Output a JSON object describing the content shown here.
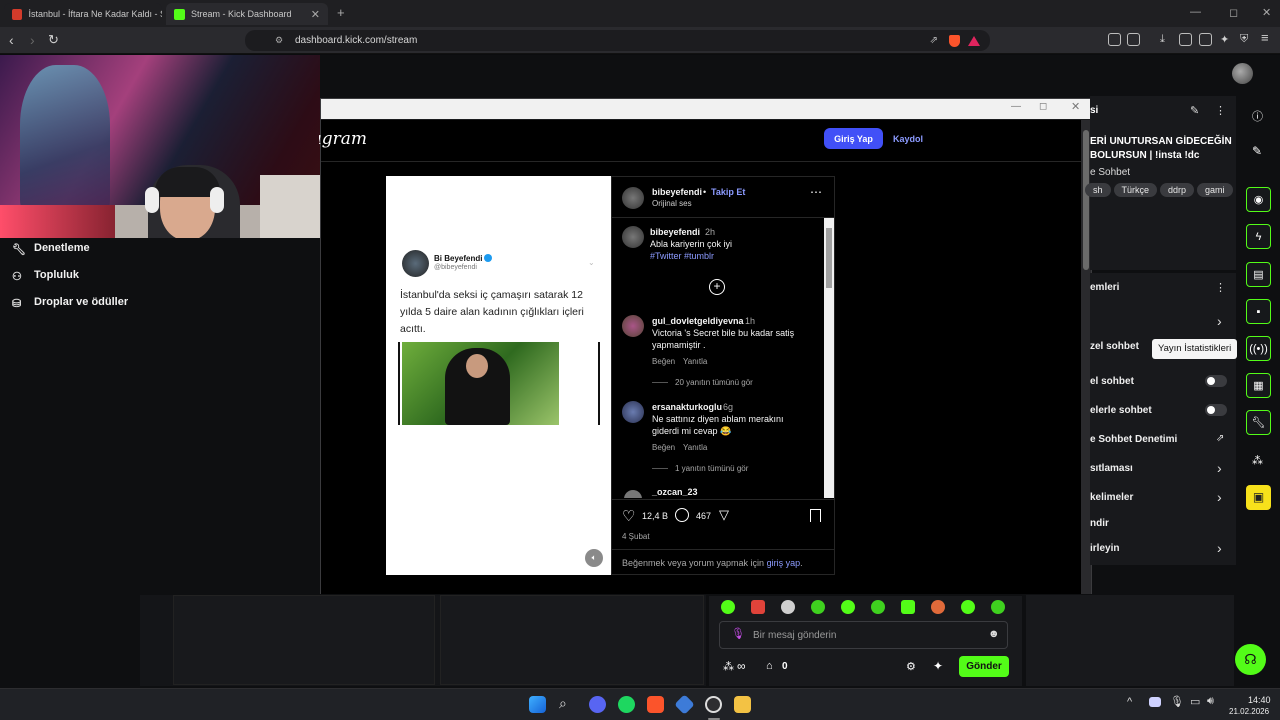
{
  "browser": {
    "tabs": [
      {
        "label": "İstanbul - İftara Ne Kadar Kaldı - Sah",
        "favicon_color": "#d23b2b"
      },
      {
        "label": "Stream - Kick Dashboard",
        "favicon_color": "#53fc18"
      }
    ],
    "new_tab": "+",
    "url": "dashboard.kick.com/stream"
  },
  "sidebar": {
    "items": [
      {
        "label": "Denetleme",
        "icon": "wrench-icon"
      },
      {
        "label": "Topluluk",
        "icon": "people-icon"
      },
      {
        "label": "Droplar ve ödüller",
        "icon": "gift-icon"
      }
    ]
  },
  "popup": {
    "instagram": {
      "logo": "Instagram",
      "login_label": "Giriş Yap",
      "signup_label": "Kaydol",
      "tweet": {
        "name": "Bi Beyefendi",
        "handle": "@bibeyefendi",
        "text": "İstanbul'da seksi iç çamaşırı satarak 12 yılda 5 daire alan kadının çığlıkları içleri acıttı."
      },
      "post": {
        "author": "bibeyefendi",
        "follow": "Takip Et",
        "audio": "Orijinal ses",
        "caption_author": "bibeyefendi",
        "caption_time": "2h",
        "caption": "Abla kariyerin çok iyi",
        "hashtags": "#Twitter #tumblr",
        "comments": [
          {
            "user": "gul_dovletgeldiyevna",
            "time": "1h",
            "text": "Victoria 's Secret bile bu kadar satiş yapmamiştir .",
            "like": "Beğen",
            "reply": "Yanıtla",
            "more": "20 yanıtın tümünü gör"
          },
          {
            "user": "ersanakturkoglu",
            "time": "6g",
            "text": "Ne sattınız diyen ablam merakını giderdi mi cevap 😂",
            "like": "Beğen",
            "reply": "Yanıtla",
            "more": "1 yanıtın tümünü gör"
          },
          {
            "user": "_ozcan_23",
            "time": "",
            "text": "",
            "like": "",
            "reply": "",
            "more": ""
          }
        ],
        "likes": "12,4 B",
        "comments_count": "467",
        "date": "4 Şubat",
        "login_prompt_prefix": "Beğenmek veya yorum yapmak için ",
        "login_prompt_link": "giriş yap",
        "login_prompt_suffix": "."
      }
    }
  },
  "stream_info": {
    "header_frag": "si",
    "title": "ERİ UNUTURSAN GİDECEĞİN BOLURSUN | !insta !dc",
    "category": "e Sohbet",
    "tags": [
      "sh",
      "Türkçe",
      "ddrp",
      "gami"
    ]
  },
  "chat_settings": {
    "header_frag": "emleri",
    "rows": [
      {
        "label": "zel sohbet",
        "control": "none"
      },
      {
        "label": "el sohbet",
        "control": "toggle"
      },
      {
        "label": "elerle sohbet",
        "control": "toggle"
      },
      {
        "label": "e Sohbet Denetimi",
        "control": "external"
      },
      {
        "label": "sıtlaması",
        "control": "chevron"
      },
      {
        "label": "kelimeler",
        "control": "chevron"
      },
      {
        "label": "ndir",
        "control": "none"
      },
      {
        "label": "irleyin",
        "control": "chevron"
      }
    ]
  },
  "tooltip": "Yayın İstatistikleri",
  "chat": {
    "placeholder": "Bir mesaj gönderin",
    "points": "∞",
    "store_count": "0",
    "send_label": "Gönder"
  },
  "taskbar": {
    "time": "14:40",
    "date": "21.02.2026"
  },
  "colors": {
    "kick_green": "#53fc18",
    "ig_blue": "#4150f7",
    "link_blue": "#8c9bff"
  }
}
